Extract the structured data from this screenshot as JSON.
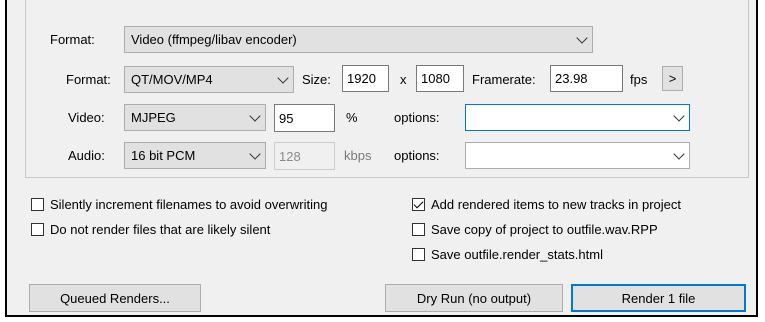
{
  "format_section": {
    "format_label": "Format:",
    "format_value": "Video (ffmpeg/libav encoder)"
  },
  "container": {
    "label": "Format:",
    "value": "QT/MOV/MP4",
    "size_label": "Size:",
    "width": "1920",
    "x_label": "x",
    "height": "1080",
    "framerate_label": "Framerate:",
    "framerate": "23.98",
    "fps_label": "fps",
    "more_label": ">"
  },
  "video": {
    "label": "Video:",
    "codec": "MJPEG",
    "quality": "95",
    "unit": "%",
    "options_label": "options:",
    "options_value": ""
  },
  "audio": {
    "label": "Audio:",
    "codec": "16 bit PCM",
    "bitrate": "128",
    "unit": "kbps",
    "options_label": "options:",
    "options_value": ""
  },
  "checkboxes": [
    {
      "label": "Silently increment filenames to avoid overwriting",
      "checked": false
    },
    {
      "label": "Do not render files that are likely silent",
      "checked": false
    },
    {
      "label": "Add rendered items to new tracks in project",
      "checked": true
    },
    {
      "label": "Save copy of project to outfile.wav.RPP",
      "checked": false
    },
    {
      "label": "Save outfile.render_stats.html",
      "checked": false
    }
  ],
  "buttons": {
    "queued_renders": "Queued Renders...",
    "dry_run": "Dry Run (no output)",
    "render": "Render 1 file"
  },
  "colors": {
    "dialog_bg": "#f0f0f0",
    "focus_border": "#0078d7"
  }
}
